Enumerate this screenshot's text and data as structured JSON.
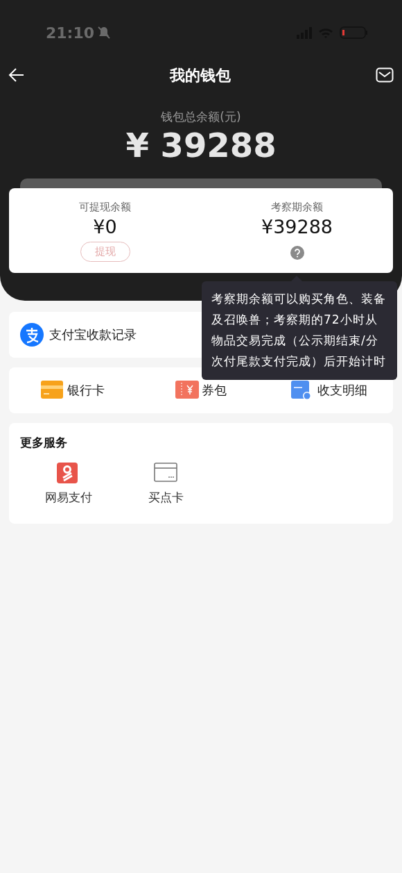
{
  "status_bar": {
    "time": "21:10"
  },
  "nav": {
    "title": "我的钱包"
  },
  "summary": {
    "label": "钱包总余额(元)",
    "amount": "¥ 39288"
  },
  "balances": [
    {
      "label": "可提现余额",
      "amount": "¥0",
      "action": "提现"
    },
    {
      "label": "考察期余额",
      "amount": "¥39288"
    }
  ],
  "tooltip": {
    "text": "考察期余额可以购买角色、装备及召唤兽；考察期的72小时从物品交易完成（公示期结束/分次付尾款支付完成）后开始计时"
  },
  "alipay_row": {
    "label": "支付宝收款记录"
  },
  "shortcuts": [
    {
      "label": "银行卡"
    },
    {
      "label": "券包"
    },
    {
      "label": "收支明细"
    }
  ],
  "more_services": {
    "title": "更多服务",
    "items": [
      {
        "label": "网易支付"
      },
      {
        "label": "买点卡"
      }
    ]
  }
}
